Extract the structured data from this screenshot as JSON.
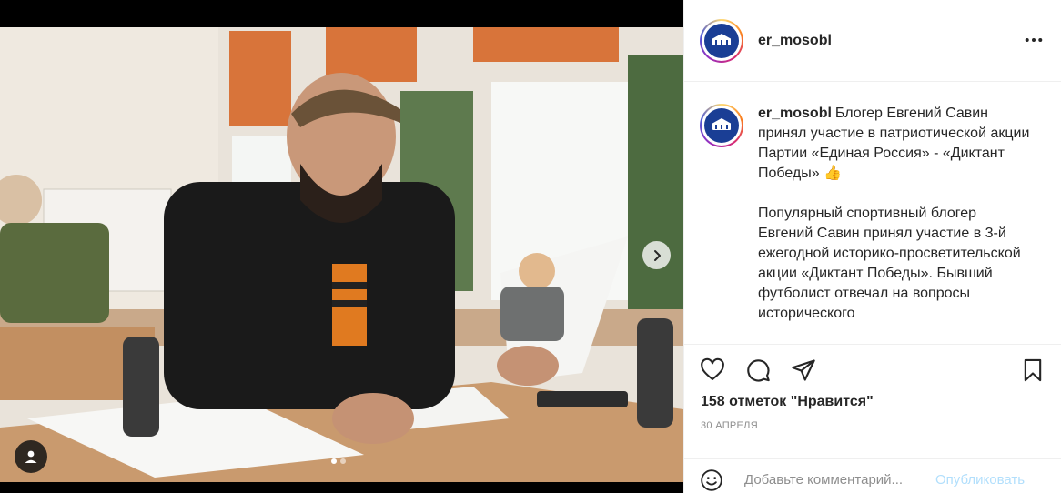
{
  "post": {
    "username": "er_mosobl",
    "caption_para1": "Блогер Евгений Савин принял участие в патриотической акции Партии «Единая Россия» - «Диктант Победы» 👍",
    "caption_para2": "Популярный спортивный блогер Евгений Савин принял участие в 3-й ежегодной историко-просветительской акции «Диктант Победы». Бывший футболист отвечал на вопросы исторического",
    "likes": "158 отметок \"Нравится\"",
    "date": "30 апреля"
  },
  "comment": {
    "placeholder": "Добавьте комментарий...",
    "publish_label": "Опубликовать"
  },
  "icons": {
    "more": "more-horizontal-icon",
    "like": "heart-icon",
    "comment": "comment-bubble-icon",
    "share": "paper-plane-icon",
    "save": "bookmark-icon",
    "emoji": "smiley-icon",
    "next": "chevron-right-icon",
    "tag": "user-tag-icon"
  },
  "carousel": {
    "slides": 2,
    "active": 1
  },
  "colors": {
    "accent_link": "#b2dffc",
    "brand_logo": "#1a3e95",
    "muted": "#8e8e8e"
  }
}
